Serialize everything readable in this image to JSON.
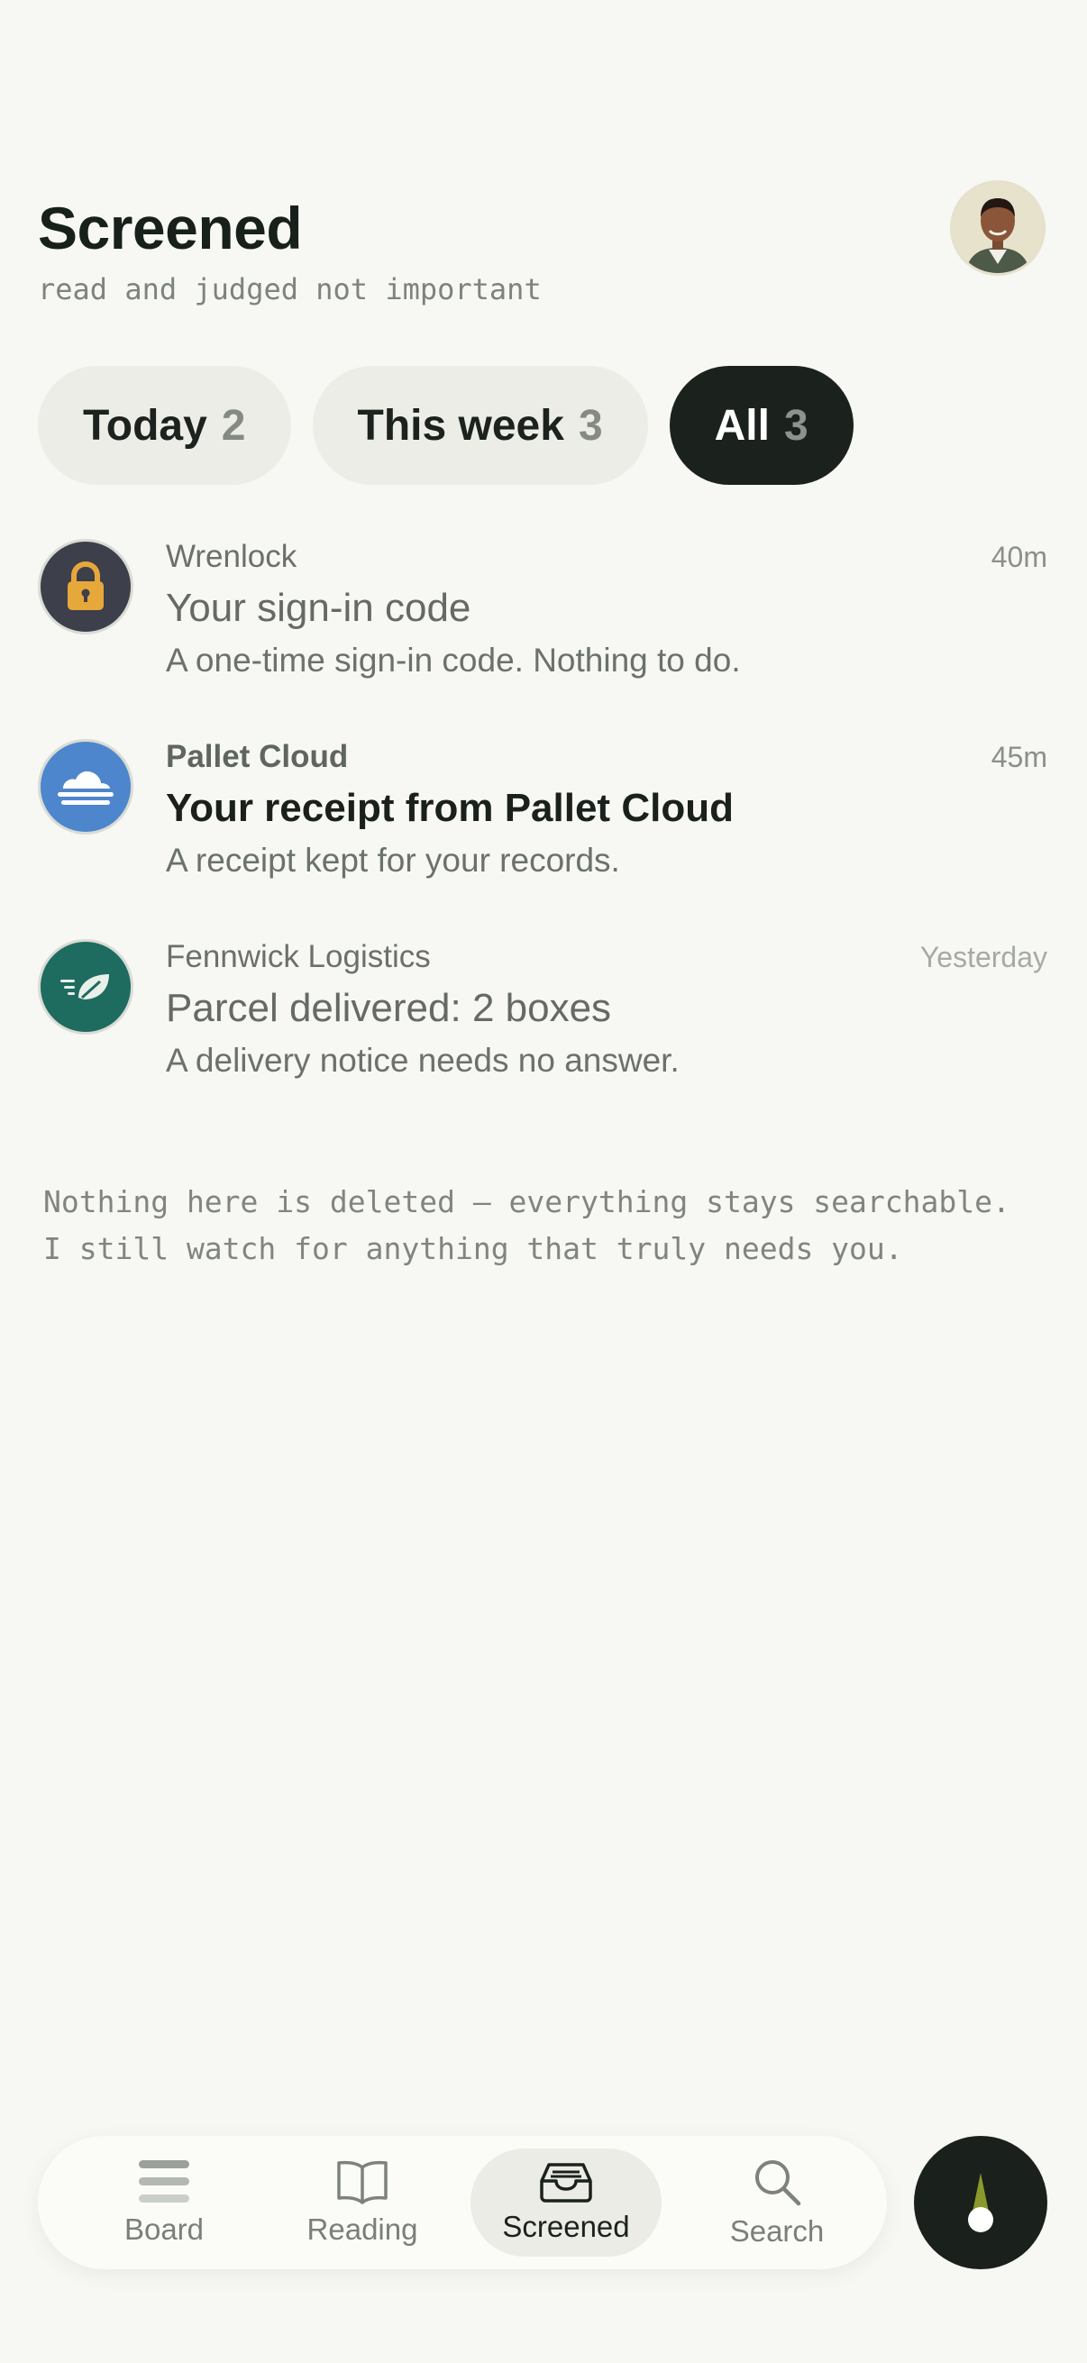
{
  "header": {
    "title": "Screened",
    "subtitle": "read and judged not important"
  },
  "filters": [
    {
      "label": "Today",
      "count": "2",
      "active": false
    },
    {
      "label": "This week",
      "count": "3",
      "active": false
    },
    {
      "label": "All",
      "count": "3",
      "active": true
    }
  ],
  "messages": [
    {
      "sender": "Wrenlock",
      "time": "40m",
      "subject": "Your sign-in code",
      "snippet": "A one-time sign-in code. Nothing to do.",
      "icon": "lock-icon",
      "color": "#3d3f4a"
    },
    {
      "sender": "Pallet Cloud",
      "time": "45m",
      "subject": "Your receipt from Pallet Cloud",
      "snippet": "A receipt kept for your records.",
      "icon": "cloud-icon",
      "color": "#4d86cc"
    },
    {
      "sender": "Fennwick Logistics",
      "time": "Yesterday",
      "subject": "Parcel delivered: 2 boxes",
      "snippet": "A delivery notice needs no answer.",
      "icon": "leaf-icon",
      "color": "#1e6b60"
    }
  ],
  "footer_note": {
    "line1": "Nothing here is deleted — everything stays searchable.",
    "line2": "I still watch for anything that truly needs you."
  },
  "nav": {
    "items": [
      {
        "label": "Board",
        "icon": "board-icon"
      },
      {
        "label": "Reading",
        "icon": "book-icon"
      },
      {
        "label": "Screened",
        "icon": "inbox-tray-icon",
        "active": true
      },
      {
        "label": "Search",
        "icon": "search-icon"
      }
    ],
    "action_icon": "compass-icon"
  },
  "colors": {
    "background": "#f7f7f3",
    "accent_dark": "#1b221d",
    "compass_needle": "#8a9a2a"
  }
}
